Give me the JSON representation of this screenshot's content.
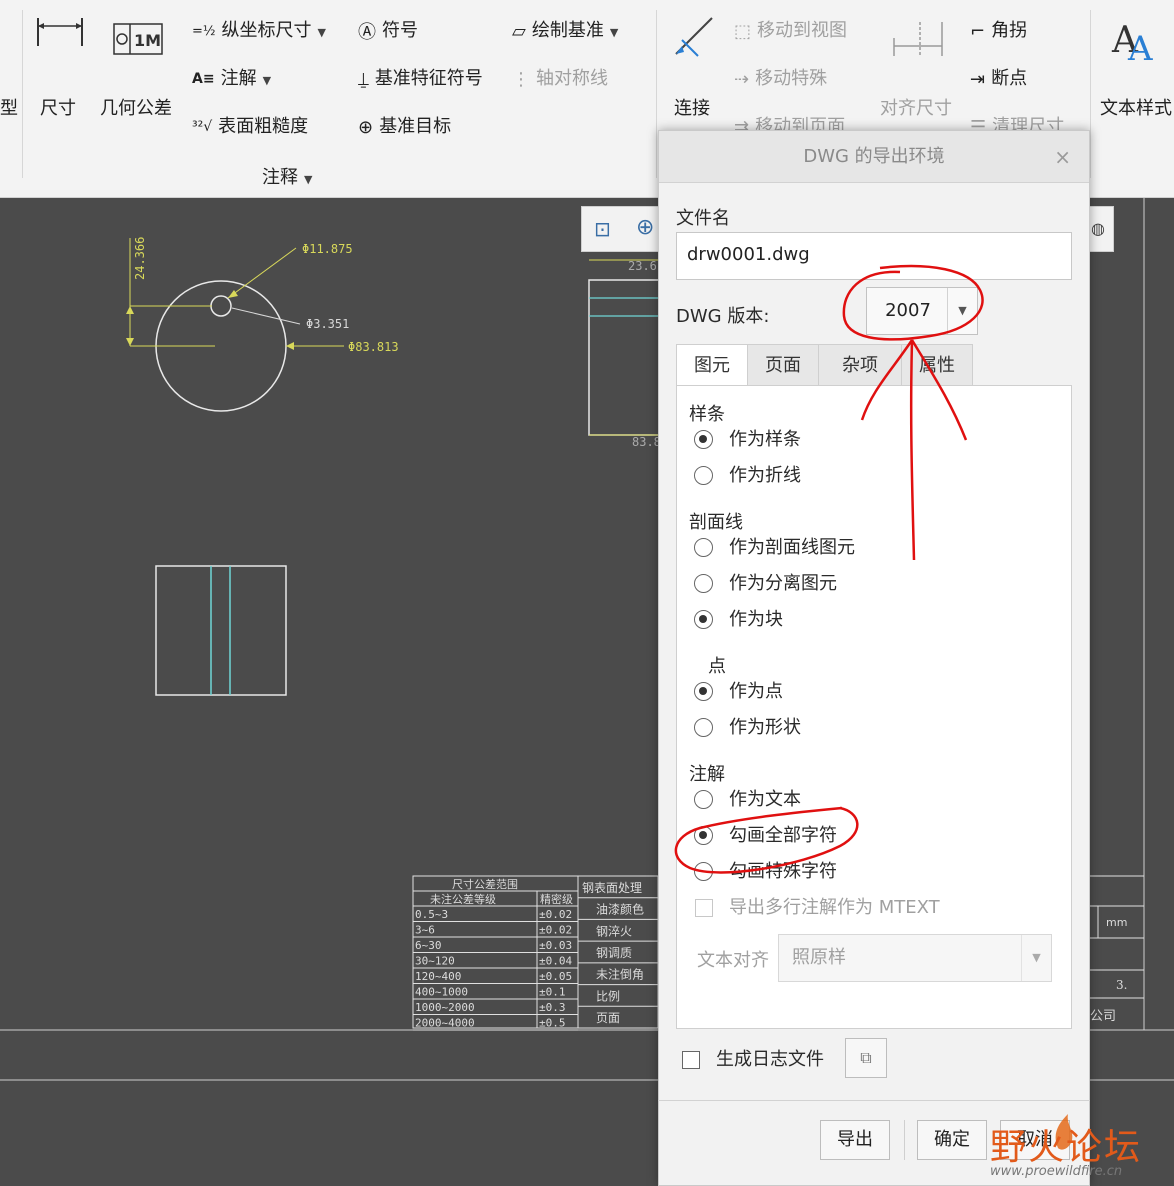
{
  "ribbon": {
    "left_cut_label": "型",
    "dimension_label": "尺寸",
    "geo_tolerance_label": "几何公差",
    "ordinate_dim_label": "纵坐标尺寸",
    "note_label": "注解",
    "surface_finish_label": "表面粗糙度",
    "symbol_label": "符号",
    "datum_feature_label": "基准特征符号",
    "datum_target_label": "基准目标",
    "draw_datum_label": "绘制基准",
    "axis_symmetry_label": "轴对称线",
    "connect_label": "连接",
    "move_to_view_label": "移动到视图",
    "move_special_label": "移动特殊",
    "move_to_sheet_label": "移动到页面",
    "align_dims_label": "对齐尺寸",
    "corner_label": "角拐",
    "breakpoint_label": "断点",
    "cleanup_dims_label": "清理尺寸",
    "text_style_label": "文本样式",
    "group_label": "注释"
  },
  "drawing": {
    "dim_top_left": "24.366",
    "dim_d1": "Φ11.875",
    "dim_d2": "Φ3.351",
    "dim_d3": "Φ83.813",
    "dim_right_top": "23.6",
    "dim_right_bottom": "83.8",
    "table_title": "尺寸公差范围",
    "table_header_1": "未注公差等级",
    "table_header_2": "精密级",
    "table_rows": [
      {
        "range": "0.5~3",
        "tol": "±0.02"
      },
      {
        "range": "3~6",
        "tol": "±0.02"
      },
      {
        "range": "6~30",
        "tol": "±0.03"
      },
      {
        "range": "30~120",
        "tol": "±0.04"
      },
      {
        "range": "120~400",
        "tol": "±0.05"
      },
      {
        "range": "400~1000",
        "tol": "±0.1"
      },
      {
        "range": "1000~2000",
        "tol": "±0.3"
      },
      {
        "range": "2000~4000",
        "tol": "±0.5"
      }
    ],
    "side_cells": [
      "钢表面处理",
      "油漆颜色",
      "钢淬火",
      "钢调质",
      "未注倒角",
      "比例",
      "页面"
    ],
    "right_unit": "mm",
    "right_num": "3.",
    "right_company": "公司"
  },
  "dialog": {
    "title": "DWG 的导出环境",
    "close": "×",
    "filename_label": "文件名",
    "filename_value": "drw0001.dwg",
    "version_label": "DWG 版本:",
    "version_value": "2007",
    "tabs": [
      "图元",
      "页面",
      "杂项",
      "属性"
    ],
    "spline_group": "样条",
    "spline_opt1": "作为样条",
    "spline_opt2": "作为折线",
    "hatch_group": "剖面线",
    "hatch_opt1": "作为剖面线图元",
    "hatch_opt2": "作为分离图元",
    "hatch_opt3": "作为块",
    "point_group": "点",
    "point_opt1": "作为点",
    "point_opt2": "作为形状",
    "note_group": "注解",
    "note_opt1": "作为文本",
    "note_opt2": "勾画全部字符",
    "note_opt3": "勾画特殊字符",
    "mtext_label": "导出多行注解作为 MTEXT",
    "text_align_label": "文本对齐",
    "text_align_value": "照原样",
    "log_label": "生成日志文件",
    "export_btn": "导出",
    "ok_btn": "确定",
    "cancel_btn": "取消"
  },
  "watermark": {
    "brand": "野火论坛",
    "url": "www.proewildfire.cn"
  }
}
